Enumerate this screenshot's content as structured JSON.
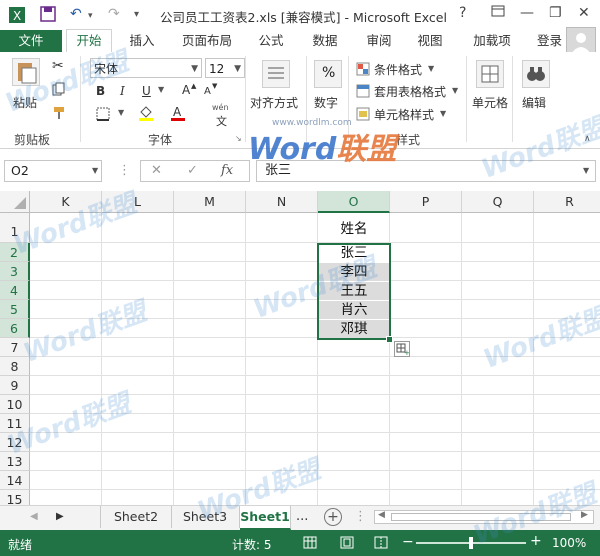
{
  "title_bar": {
    "title": "公司员工工资表2.xls  [兼容模式] - Microsoft Excel",
    "help": "?",
    "minimize": "—",
    "close": "✕",
    "restore": "❐"
  },
  "tabs": {
    "file": "文件",
    "items": [
      "开始",
      "插入",
      "页面布局",
      "公式",
      "数据",
      "审阅",
      "视图",
      "加载项"
    ],
    "active": "开始",
    "user": "登录"
  },
  "ribbon": {
    "clipboard": {
      "paste": "粘贴",
      "label": "剪贴板"
    },
    "font": {
      "name": "宋体",
      "size": "12",
      "bold": "B",
      "italic": "I",
      "underline": "U",
      "label": "字体",
      "wen": "wén",
      "wen_char": "文"
    },
    "alignment": {
      "button": "对齐方式"
    },
    "number": {
      "button": "数字",
      "percent": "%"
    },
    "styles": {
      "conditional": "条件格式",
      "table": "套用表格格式",
      "cell": "单元格样式",
      "label": "样式"
    },
    "cells": {
      "button": "单元格"
    },
    "editing": {
      "button": "编辑"
    }
  },
  "formula_bar": {
    "name_box": "O2",
    "cancel": "✕",
    "enter": "✓",
    "fx": "fx",
    "value": "张三"
  },
  "grid": {
    "columns": [
      "K",
      "L",
      "M",
      "N",
      "O",
      "P",
      "Q",
      "R"
    ],
    "selected_column": "O",
    "rows": [
      "1",
      "2",
      "3",
      "4",
      "5",
      "6",
      "7",
      "8",
      "9",
      "10",
      "11",
      "12",
      "13",
      "14",
      "15"
    ],
    "header_cell": "姓名",
    "names": [
      "张三",
      "李四",
      "王五",
      "肖六",
      "邓琪"
    ]
  },
  "sheets": {
    "tabs": [
      "Sheet2",
      "Sheet3",
      "Sheet1"
    ],
    "active": "Sheet1",
    "more": "...",
    "add": "+"
  },
  "status": {
    "ready": "就绪",
    "count": "计数: 5",
    "zoom_minus": "−",
    "zoom_plus": "+",
    "zoom_level": "100%"
  },
  "watermark": {
    "word": "Word",
    "cn": "联盟",
    "url": "www.wordlm.com"
  },
  "colors": {
    "accent": "#217346",
    "selection_fill": "#dcdcdc"
  }
}
